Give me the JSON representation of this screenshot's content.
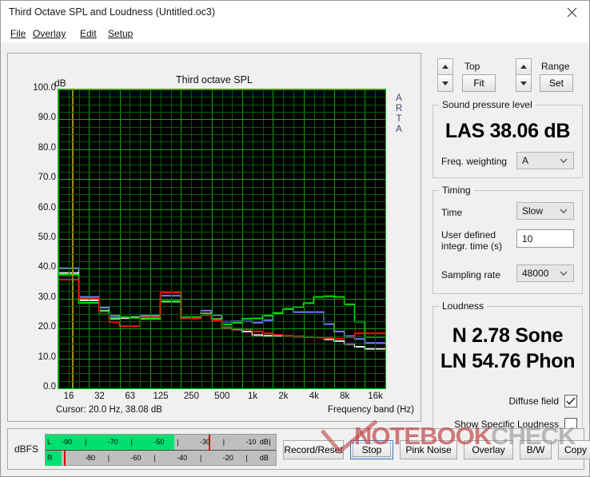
{
  "window": {
    "title": "Third Octave SPL and Loudness (Untitled.oc3)",
    "close_icon": "close-icon"
  },
  "menu": [
    {
      "label": "File",
      "accel": "F"
    },
    {
      "label": "Overlay",
      "accel": "O"
    },
    {
      "label": "Edit",
      "accel": "E"
    },
    {
      "label": "Setup",
      "accel": "S"
    }
  ],
  "graph": {
    "title": "Third octave SPL",
    "y_axis_unit": "dB",
    "x_axis_label": "Frequency band (Hz)",
    "cursor_readout": "Cursor:   20.0 Hz, 38.08 dB",
    "watermark_vertical": "ARTA"
  },
  "controls": {
    "top_label": "Top",
    "top_button": "Fit",
    "range_label": "Range",
    "range_button": "Set",
    "spl_group": "Sound pressure level",
    "spl_value": "LAS 38.06 dB",
    "freq_weighting_label": "Freq. weighting",
    "freq_weighting_value": "A",
    "timing_group": "Timing",
    "time_label": "Time",
    "time_value": "Slow",
    "integr_label": "User defined\nintegr. time (s)",
    "integr_label_line1": "User defined",
    "integr_label_line2": "integr. time (s)",
    "integr_value": "10",
    "sampling_label": "Sampling rate",
    "sampling_value": "48000",
    "loudness_group": "Loudness",
    "loudness_sone": "N 2.78 Sone",
    "loudness_phon": "LN 54.76 Phon",
    "diffuse_field_label": "Diffuse field",
    "diffuse_field_checked": true,
    "specific_loudness_label": "Show Specific Loudness",
    "specific_loudness_checked": false
  },
  "meter": {
    "unit_label": "dBFS",
    "left_channel": "L",
    "right_channel": "R",
    "unit_suffix": "dB",
    "top_ticks": [
      "-90",
      "-70",
      "-50",
      "-30",
      "-10"
    ],
    "bottom_ticks": [
      "-80",
      "-60",
      "-40",
      "-20"
    ],
    "left_level_pct": 56,
    "right_level_pct": 7,
    "left_peak_pct": 71,
    "right_peak_pct": 8
  },
  "buttons": [
    {
      "label": "Record/Reset",
      "focused": false
    },
    {
      "label": "Stop",
      "focused": true
    },
    {
      "label": "Pink Noise",
      "focused": false
    },
    {
      "label": "Overlay",
      "focused": false
    },
    {
      "label": "B/W",
      "focused": false
    },
    {
      "label": "Copy",
      "focused": false
    }
  ],
  "watermark": {
    "primary": "NOTEBOOK",
    "secondary": "CHECK",
    "primary_color": "#c04a4a",
    "secondary_color": "#8a8a8a"
  },
  "chart_data": {
    "type": "line",
    "title": "Third octave SPL",
    "xlabel": "Frequency band (Hz)",
    "ylabel": "dB",
    "ylim": [
      0,
      100
    ],
    "ytick_step": 10,
    "yticks": [
      "0.0",
      "10.0",
      "20.0",
      "30.0",
      "40.0",
      "50.0",
      "60.0",
      "70.0",
      "80.0",
      "90.0",
      "100.0"
    ],
    "xticks": [
      "16",
      "32",
      "63",
      "125",
      "250",
      "500",
      "1k",
      "2k",
      "4k",
      "8k",
      "16k"
    ],
    "grid": true,
    "grid_color": "#0b5a0b",
    "grid_major_color": "#14a014",
    "background": "#000000",
    "cursor_frequency_hz": 20.0,
    "cursor_level_db": 38.08,
    "categories": [
      16,
      20,
      25,
      31.5,
      40,
      50,
      63,
      80,
      100,
      125,
      160,
      200,
      250,
      315,
      400,
      500,
      630,
      800,
      1000,
      1250,
      1600,
      2000,
      2500,
      3150,
      4000,
      5000,
      6300,
      8000,
      10000,
      12500,
      16000,
      20000
    ],
    "series": [
      {
        "name": "blue",
        "color": "#7a7aff",
        "values": [
          40.2,
          40.2,
          30.6,
          30.6,
          27.0,
          24.3,
          23.5,
          23.8,
          24.3,
          24.3,
          31.0,
          31.0,
          23.7,
          23.7,
          26.0,
          24.5,
          22.3,
          22.4,
          22.4,
          22.0,
          22.8,
          24.9,
          26.5,
          25.5,
          25.5,
          25.5,
          21.5,
          19.0,
          17.5,
          16.5,
          15.2,
          15.2
        ]
      },
      {
        "name": "white",
        "color": "#e8e8e8",
        "values": [
          38.6,
          38.6,
          29.4,
          29.4,
          26.0,
          23.3,
          23.5,
          23.8,
          23.6,
          23.6,
          29.0,
          29.0,
          23.5,
          23.5,
          25.0,
          23.2,
          20.4,
          19.7,
          19.0,
          17.8,
          17.6,
          17.5,
          17.4,
          17.3,
          17.2,
          17.1,
          16.4,
          15.8,
          14.8,
          13.9,
          13.2,
          13.2
        ]
      },
      {
        "name": "green",
        "color": "#00e000",
        "values": [
          38.0,
          38.0,
          28.6,
          28.6,
          25.8,
          23.6,
          23.8,
          23.6,
          23.2,
          23.2,
          29.2,
          29.2,
          23.8,
          23.8,
          24.8,
          23.1,
          21.4,
          21.9,
          23.3,
          23.4,
          24.3,
          25.2,
          26.6,
          27.2,
          28.5,
          30.6,
          30.8,
          30.6,
          28.1,
          22.3,
          17.2,
          17.2
        ]
      },
      {
        "name": "red",
        "color": "#ff1010",
        "values": [
          36.4,
          36.4,
          30.2,
          30.2,
          24.8,
          22.2,
          20.8,
          20.8,
          23.8,
          23.8,
          32.0,
          32.0,
          23.5,
          23.5,
          24.5,
          22.8,
          20.3,
          19.9,
          19.8,
          19.0,
          18.4,
          17.9,
          17.6,
          17.4,
          17.2,
          17.0,
          16.8,
          16.6,
          17.1,
          18.4,
          18.4,
          18.4
        ]
      }
    ]
  }
}
